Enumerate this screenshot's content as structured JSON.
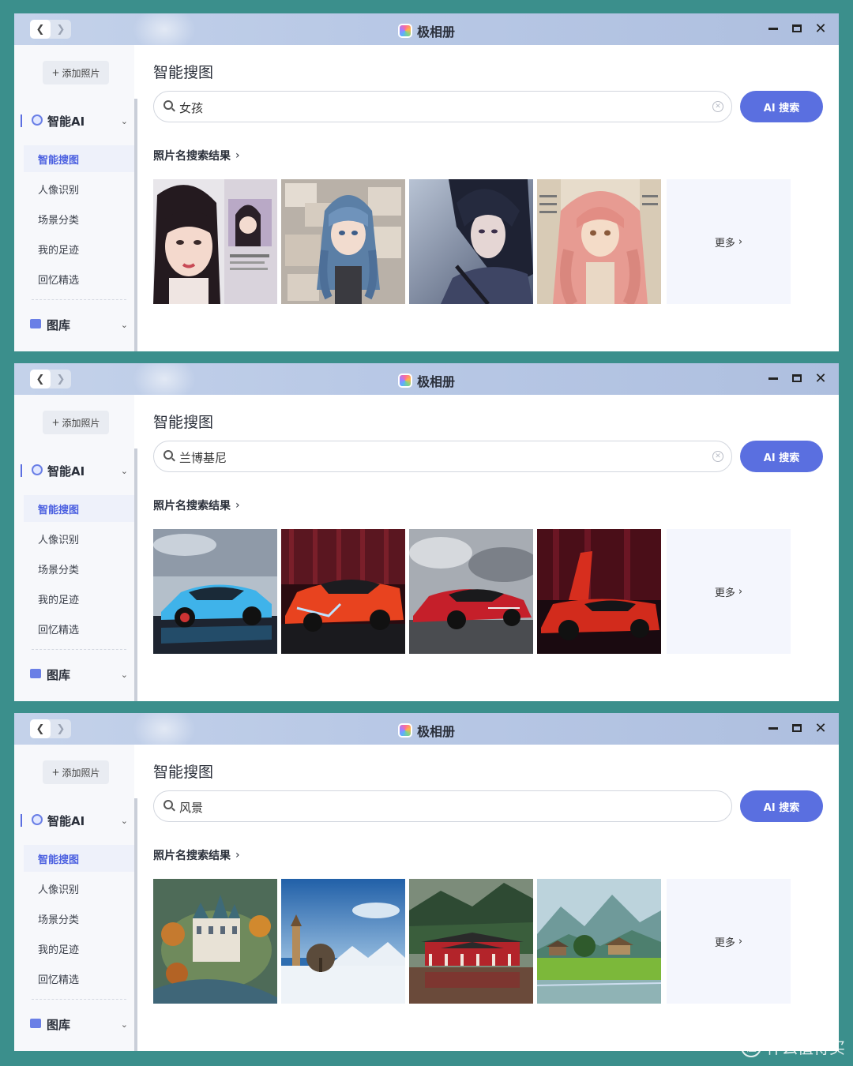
{
  "app": {
    "title": "极相册"
  },
  "sidebar": {
    "add_label": "添加照片",
    "section_ai": "智能AI",
    "items": [
      "智能搜图",
      "人像识别",
      "场景分类",
      "我的足迹",
      "回忆精选"
    ],
    "section_library": "图库"
  },
  "main": {
    "page_title": "智能搜图",
    "ai_button": "AI 搜索",
    "results_heading": "照片名搜索结果",
    "more_label": "更多"
  },
  "panels": [
    {
      "query": "女孩",
      "has_clear": true,
      "thumbs": [
        "girl-magazine",
        "girl-blue-hair",
        "girl-rain",
        "girl-pink-hair"
      ]
    },
    {
      "query": "兰博基尼",
      "has_clear": true,
      "thumbs": [
        "car-blue",
        "car-orange-red",
        "car-red-clouds",
        "car-red-doors"
      ]
    },
    {
      "query": "风景",
      "has_clear": false,
      "thumbs": [
        "castle-island",
        "snow-mountain-church",
        "red-temple",
        "mountain-rice-field"
      ]
    }
  ],
  "watermark": {
    "text": "什么值得买",
    "icon": "值"
  },
  "colors": {
    "accent": "#5a6fe0",
    "background": "#3b8f8c"
  }
}
